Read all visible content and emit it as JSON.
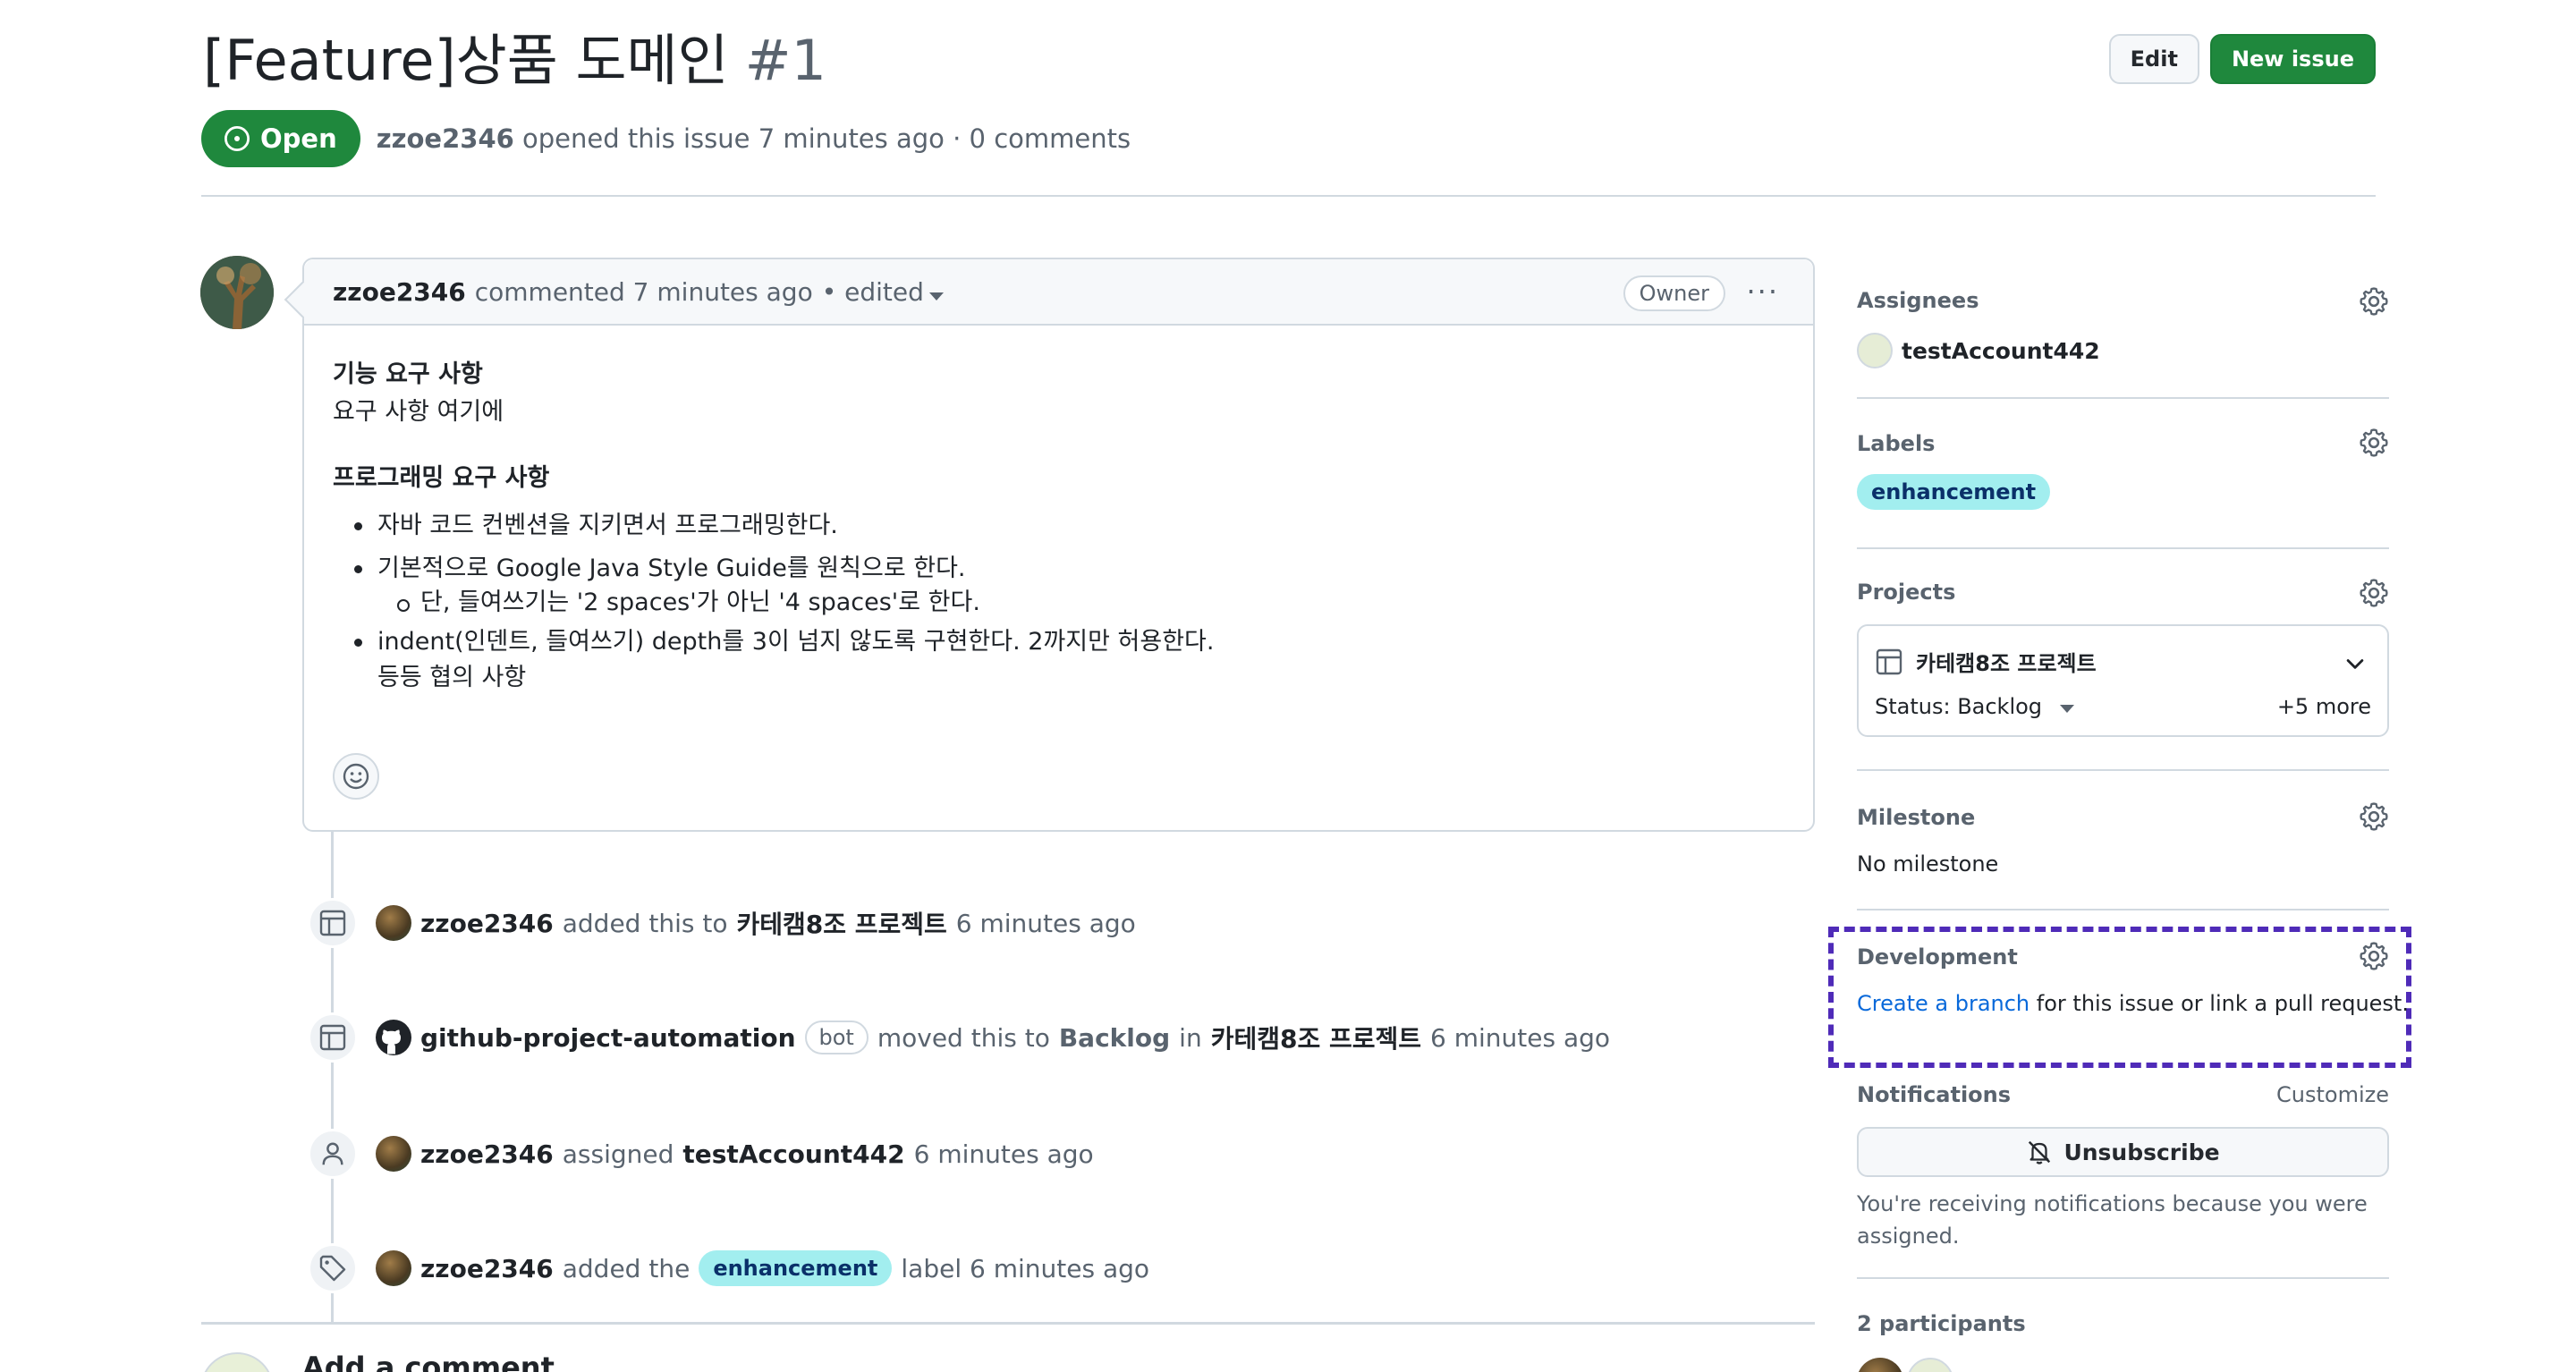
{
  "issue": {
    "title": "[Feature]상품 도메인",
    "number": "#1",
    "state": "Open",
    "author": "zzoe2346",
    "opened_text": "opened this issue 7 minutes ago · 0 comments"
  },
  "header_actions": {
    "edit_label": "Edit",
    "new_issue_label": "New issue"
  },
  "comment": {
    "author": "zzoe2346",
    "meta": "commented 7 minutes ago",
    "edited": "• edited",
    "owner_badge": "Owner",
    "heading1": "기능 요구 사항",
    "line1": "요구 사항 여기에",
    "heading2": "프로그래밍 요구 사항",
    "bullets": [
      "자바 코드 컨벤션을 지키면서 프로그래밍한다.",
      "기본적으로 Google Java Style Guide를 원칙으로 한다.",
      "단, 들여쓰기는 '2 spaces'가 아닌 '4 spaces'로 한다.",
      "indent(인덴트, 들여쓰기) depth를 3이 넘지 않도록 구현한다. 2까지만 허용한다.",
      "등등 협의 사항"
    ]
  },
  "events": [
    {
      "actor": "zzoe2346",
      "text1": "added this to",
      "target": "카테캠8조 프로젝트",
      "time": "6 minutes ago"
    },
    {
      "actor": "github-project-automation",
      "badge": "bot",
      "text1": "moved this to",
      "status": "Backlog",
      "text2": "in",
      "target": "카테캠8조 프로젝트",
      "time": "6 minutes ago"
    },
    {
      "actor": "zzoe2346",
      "text1": "assigned",
      "target": "testAccount442",
      "time": "6 minutes ago"
    },
    {
      "actor": "zzoe2346",
      "text1": "added the",
      "label": "enhancement",
      "text2": "label 6 minutes ago"
    }
  ],
  "add_comment": "Add a comment",
  "sidebar": {
    "assignees": {
      "heading": "Assignees",
      "user": "testAccount442"
    },
    "labels": {
      "heading": "Labels",
      "label": "enhancement"
    },
    "projects": {
      "heading": "Projects",
      "name": "카테캠8조 프로젝트",
      "status": "Status: Backlog",
      "more": "+5 more"
    },
    "milestone": {
      "heading": "Milestone",
      "value": "No milestone"
    },
    "development": {
      "heading": "Development",
      "link": "Create a branch",
      "text": "for this issue or link a pull request."
    },
    "notifications": {
      "heading": "Notifications",
      "customize": "Customize",
      "button": "Unsubscribe",
      "note": "You're receiving notifications because you were assigned."
    },
    "participants": {
      "heading": "2 participants"
    }
  },
  "colors": {
    "open_green": "#1f883d",
    "label_bg": "#a2eeef",
    "link_blue": "#0969da",
    "highlight_purple": "#4f2bb8"
  }
}
